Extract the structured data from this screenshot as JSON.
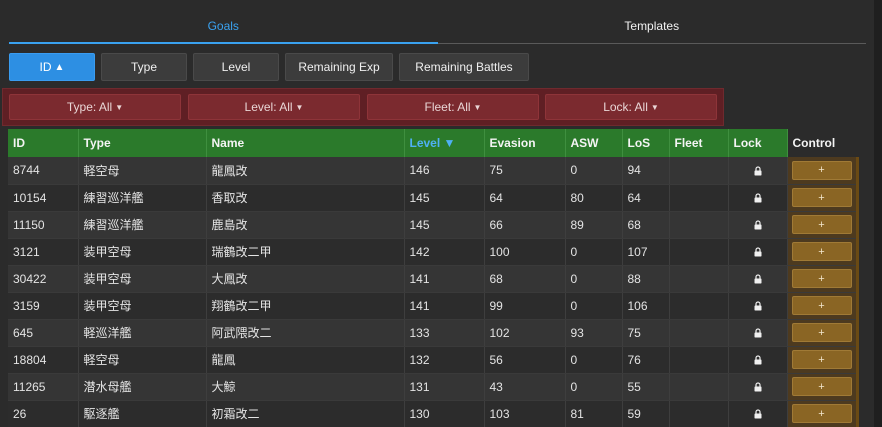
{
  "tabs": [
    {
      "label": "Goals",
      "active": true
    },
    {
      "label": "Templates",
      "active": false
    }
  ],
  "sort_buttons": [
    {
      "label": "ID",
      "indicator": "▲",
      "active": true
    },
    {
      "label": "Type",
      "indicator": "",
      "active": false
    },
    {
      "label": "Level",
      "indicator": "",
      "active": false
    },
    {
      "label": "Remaining Exp",
      "indicator": "",
      "active": false
    },
    {
      "label": "Remaining Battles",
      "indicator": "",
      "active": false
    }
  ],
  "filters": [
    {
      "label": "Type: All"
    },
    {
      "label": "Level: All"
    },
    {
      "label": "Fleet: All"
    },
    {
      "label": "Lock: All"
    }
  ],
  "table": {
    "headers": [
      "ID",
      "Type",
      "Name",
      "Level ▼",
      "Evasion",
      "ASW",
      "LoS",
      "Fleet",
      "Lock",
      "Control"
    ],
    "rows": [
      [
        "8744",
        "軽空母",
        "龍鳳改",
        "146",
        "75",
        "0",
        "94",
        ""
      ],
      [
        "10154",
        "練習巡洋艦",
        "香取改",
        "145",
        "64",
        "80",
        "64",
        ""
      ],
      [
        "11150",
        "練習巡洋艦",
        "鹿島改",
        "145",
        "66",
        "89",
        "68",
        ""
      ],
      [
        "3121",
        "装甲空母",
        "瑞鶴改二甲",
        "142",
        "100",
        "0",
        "107",
        ""
      ],
      [
        "30422",
        "装甲空母",
        "大鳳改",
        "141",
        "68",
        "0",
        "88",
        ""
      ],
      [
        "3159",
        "装甲空母",
        "翔鶴改二甲",
        "141",
        "99",
        "0",
        "106",
        ""
      ],
      [
        "645",
        "軽巡洋艦",
        "阿武隈改二",
        "133",
        "102",
        "93",
        "75",
        ""
      ],
      [
        "18804",
        "軽空母",
        "龍鳳",
        "132",
        "56",
        "0",
        "76",
        ""
      ],
      [
        "11265",
        "潜水母艦",
        "大鯨",
        "131",
        "43",
        "0",
        "55",
        ""
      ],
      [
        "26",
        "駆逐艦",
        "初霜改二",
        "130",
        "103",
        "81",
        "59",
        ""
      ]
    ],
    "control_label": "+"
  },
  "colors": {
    "accent": "#3aa2f0",
    "header_green": "#2b7a2b",
    "filter_red": "#7b2a2f",
    "control_brown": "#8a6524"
  }
}
